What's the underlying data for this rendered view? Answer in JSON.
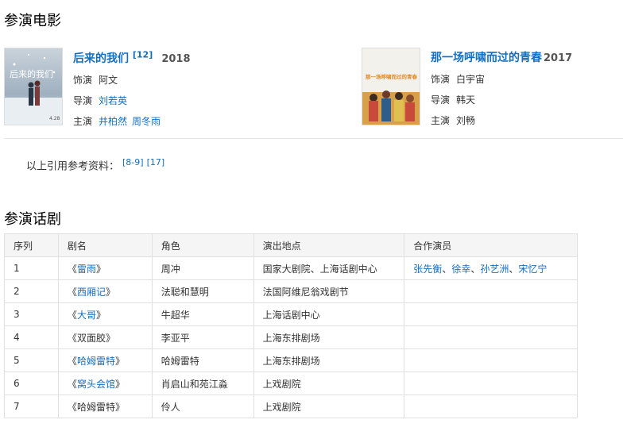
{
  "films_section": {
    "title": "参演电影"
  },
  "films": [
    {
      "title": "后来的我们",
      "ref": "[12]",
      "year": "2018",
      "poster_text": "后来的我们",
      "poster_date": "4.28",
      "role_label": "饰演",
      "role": "阿文",
      "director_label": "导演",
      "director": "刘若英",
      "cast_label": "主演",
      "cast": [
        "井柏然",
        "周冬雨"
      ]
    },
    {
      "title": "那一场呼啸而过的青春",
      "ref": "",
      "year": "2017",
      "poster_text": "那一场呼啸而过的青春",
      "role_label": "饰演",
      "role": "白宇宙",
      "director_label": "导演",
      "director": "韩天",
      "cast_label": "主演",
      "cast": [
        "刘畅"
      ]
    }
  ],
  "references": {
    "label": "以上引用参考资料：",
    "items": [
      "[8-9]",
      "[17]"
    ]
  },
  "plays_section": {
    "title": "参演话剧"
  },
  "plays_table": {
    "headers": [
      "序列",
      "剧名",
      "角色",
      "演出地点",
      "合作演员"
    ],
    "rows": [
      {
        "no": "1",
        "title": "雷雨",
        "linked": true,
        "role": "周冲",
        "venue": "国家大剧院、上海话剧中心",
        "partners": [
          "张先衡",
          "徐幸",
          "孙艺洲",
          "宋忆宁"
        ]
      },
      {
        "no": "2",
        "title": "西厢记",
        "linked": true,
        "role": "法聪和慧明",
        "venue": "法国阿维尼翁戏剧节",
        "partners": []
      },
      {
        "no": "3",
        "title": "大哥",
        "linked": true,
        "role": "牛超华",
        "venue": "上海话剧中心",
        "partners": []
      },
      {
        "no": "4",
        "title": "双面胶",
        "linked": false,
        "role": "李亚平",
        "venue": "上海东排剧场",
        "partners": []
      },
      {
        "no": "5",
        "title": "哈姆雷特",
        "linked": true,
        "role": "哈姆雷特",
        "venue": "上海东排剧场",
        "partners": []
      },
      {
        "no": "6",
        "title": "窝头会馆",
        "linked": true,
        "role": "肖启山和苑江淼",
        "venue": "上戏剧院",
        "partners": []
      },
      {
        "no": "7",
        "title": "哈姆雷特",
        "linked": false,
        "role": "伶人",
        "venue": "上戏剧院",
        "partners": []
      }
    ]
  },
  "colors": {
    "link": "#136ec2",
    "border": "#e0e0e0",
    "header_bg": "#f5f5f5"
  }
}
